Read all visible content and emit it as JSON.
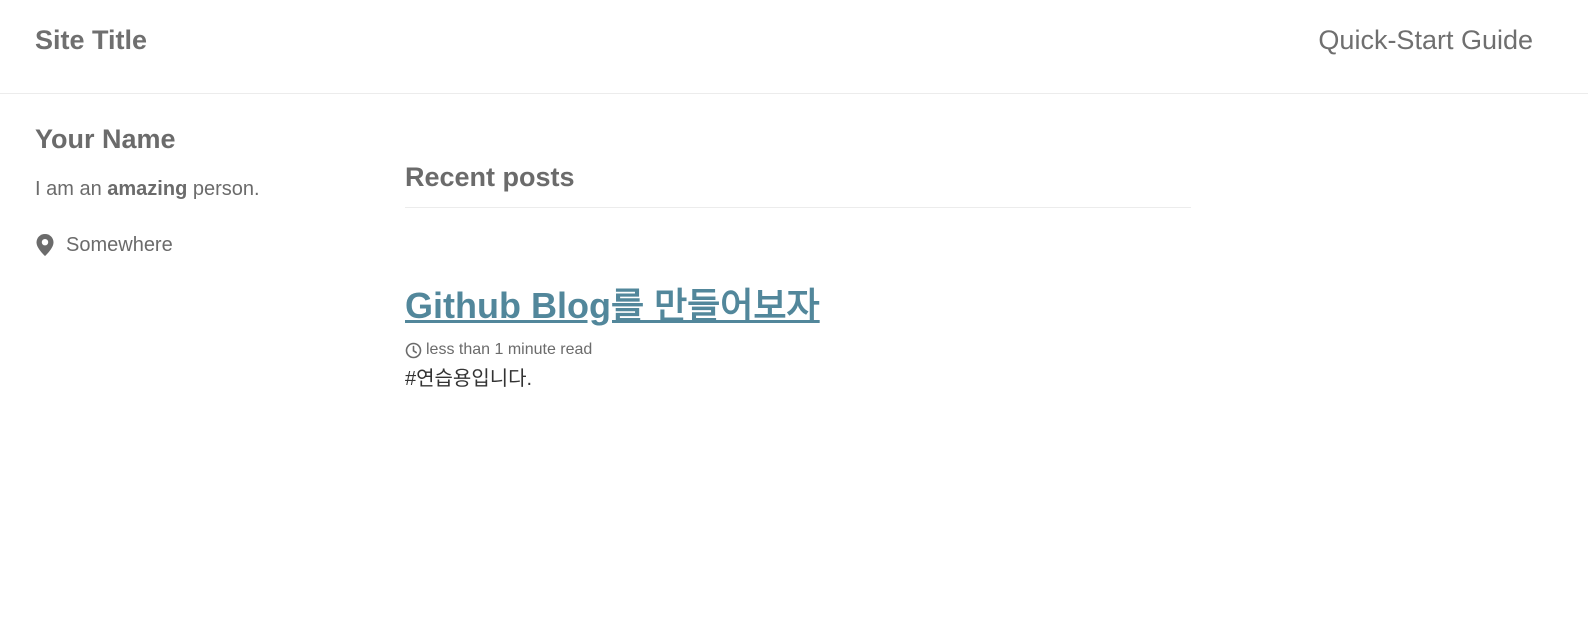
{
  "masthead": {
    "site_title": "Site Title",
    "nav_items": [
      {
        "label": "Quick-Start Guide"
      }
    ]
  },
  "sidebar": {
    "author_name": "Your Name",
    "bio_prefix": "I am an ",
    "bio_emphasis": "amazing",
    "bio_suffix": " person.",
    "location": "Somewhere",
    "location_icon": "map-marker-icon"
  },
  "main": {
    "section_title": "Recent posts",
    "posts": [
      {
        "title": "Github Blog를 만들어보자",
        "read_time": "less than 1 minute read",
        "read_time_icon": "clock-icon",
        "excerpt": "#연습용입니다."
      }
    ]
  },
  "colors": {
    "text": "#6b6b6b",
    "link": "#52879b",
    "divider": "#ececec",
    "excerpt": "#333333"
  }
}
